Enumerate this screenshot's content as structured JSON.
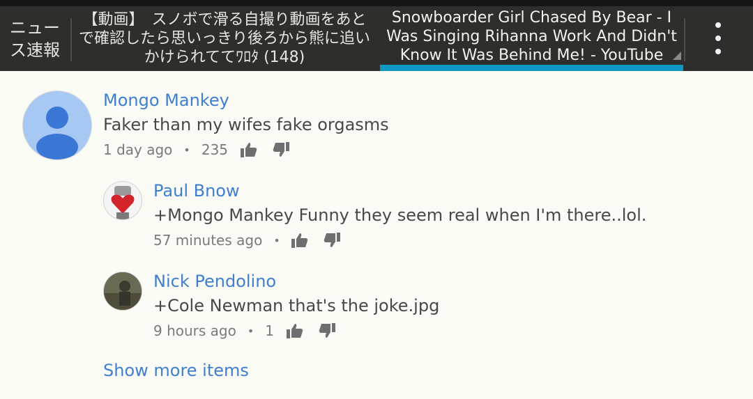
{
  "tabs": {
    "news": {
      "line1": "ニュー",
      "line2": "ス速報"
    },
    "japanese": {
      "title": "【動画】　スノボで滑る自撮り動画をあとで確認したら思いっきり後ろから熊に追いかけられててﾜﾛﾀ (148)"
    },
    "youtube": {
      "title": "Snowboarder Girl Chased By Bear - I Was Singing Rihanna Work And Didn't Know It Was Behind Me! - YouTube",
      "active": true
    }
  },
  "menu": {
    "icon": "more-vert-icon"
  },
  "colors": {
    "accent": "#0f98c4",
    "link": "#3f7fcf",
    "tabbar": "#2e2e2c"
  },
  "comments": [
    {
      "author": "Mongo Mankey",
      "text": "Faker than my wifes fake orgasms",
      "time": "1 day ago",
      "likes": "235",
      "avatar": "default-person-avatar"
    },
    {
      "author": "Paul Bnow",
      "text": "+Mongo Mankey Funny they seem real when I'm there..lol.",
      "time": "57 minutes ago",
      "likes": "",
      "avatar": "red-heart-fist-avatar"
    },
    {
      "author": "Nick Pendolino",
      "text": "+Cole Newman that's the joke.jpg",
      "time": "9 hours ago",
      "likes": "1",
      "avatar": "photo-avatar"
    }
  ],
  "show_more": "Show more items"
}
